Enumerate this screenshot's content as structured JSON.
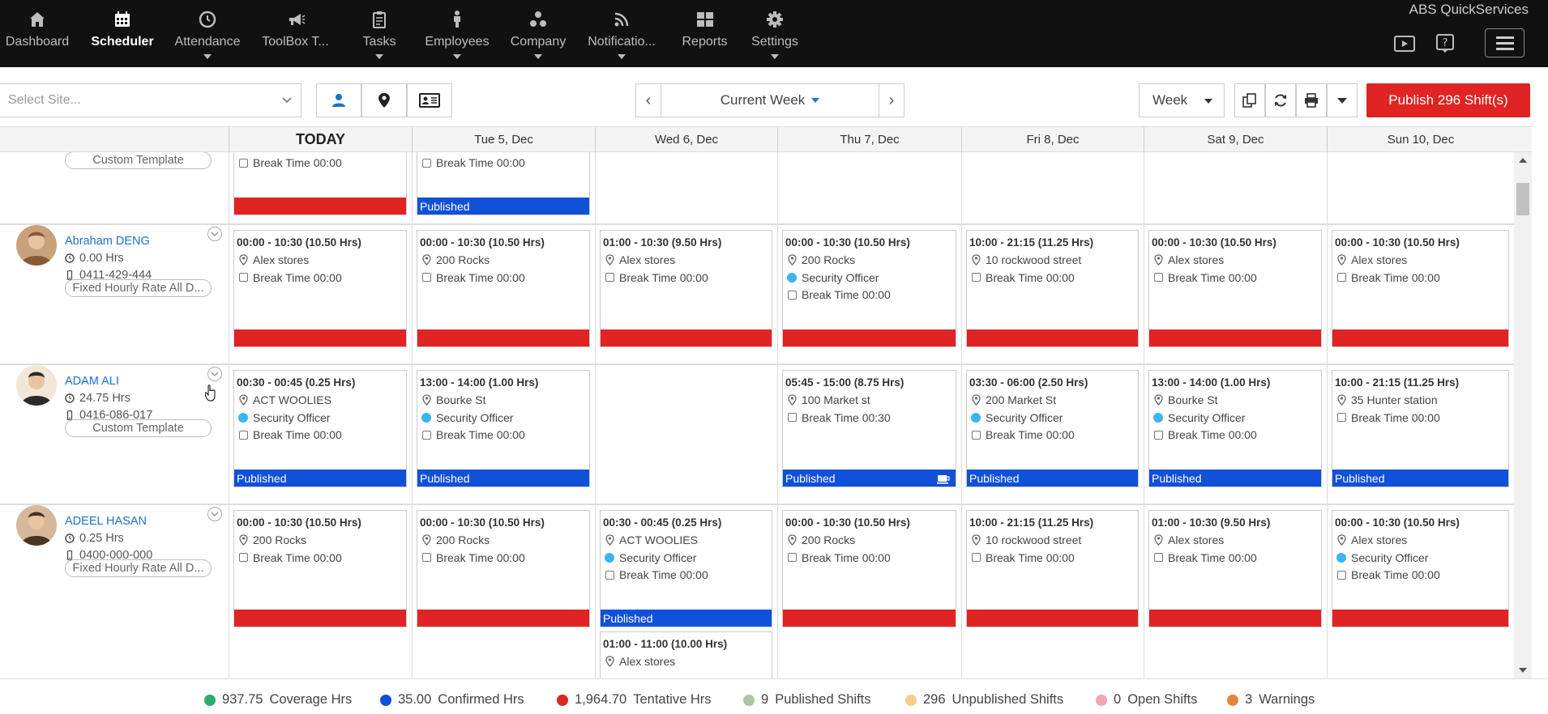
{
  "app": {
    "brand": "ABS QuickServices"
  },
  "nav": {
    "items": [
      {
        "label": "Dashboard",
        "icon": "home-icon"
      },
      {
        "label": "Scheduler",
        "icon": "calendar-icon",
        "active": true
      },
      {
        "label": "Attendance",
        "icon": "clock-icon"
      },
      {
        "label": "ToolBox T...",
        "icon": "megaphone-icon"
      },
      {
        "label": "Tasks",
        "icon": "clipboard-icon"
      },
      {
        "label": "Employees",
        "icon": "person-icon"
      },
      {
        "label": "Company",
        "icon": "org-icon"
      },
      {
        "label": "Notificatio...",
        "icon": "rss-icon"
      },
      {
        "label": "Reports",
        "icon": "grid-icon"
      },
      {
        "label": "Settings",
        "icon": "gear-icon"
      }
    ]
  },
  "toolbar": {
    "site_placeholder": "Select Site...",
    "week_label": "Current Week",
    "prev": "‹",
    "next": "›",
    "view": "Week",
    "publish_label": "Publish 296 Shift(s)"
  },
  "days": [
    "TODAY",
    "Tue 5, Dec",
    "Wed 6, Dec",
    "Thu 7, Dec",
    "Fri 8, Dec",
    "Sat 9, Dec",
    "Sun 10, Dec"
  ],
  "top_partial": {
    "employee_tag": "Custom Template",
    "cells": [
      {
        "lines": [
          {
            "type": "break",
            "text": "Break Time 00:00"
          }
        ],
        "status": ""
      },
      {
        "lines": [
          {
            "type": "break",
            "text": "Break Time 00:00"
          }
        ],
        "status": "Published"
      }
    ]
  },
  "employees": [
    {
      "name": "Abraham DENG",
      "hours": "0.00 Hrs",
      "phone": "0411-429-444",
      "tag": "Fixed Hourly Rate All D...",
      "shifts": [
        {
          "day": 0,
          "time": "00:00 - 10:30 (10.50 Hrs)",
          "lines": [
            {
              "type": "loc",
              "text": "Alex stores"
            },
            {
              "type": "break",
              "text": "Break Time 00:00"
            }
          ],
          "status": ""
        },
        {
          "day": 1,
          "time": "00:00 - 10:30 (10.50 Hrs)",
          "lines": [
            {
              "type": "loc",
              "text": "200 Rocks"
            },
            {
              "type": "break",
              "text": "Break Time 00:00"
            }
          ],
          "status": ""
        },
        {
          "day": 2,
          "time": "01:00 - 10:30 (9.50 Hrs)",
          "lines": [
            {
              "type": "loc",
              "text": "Alex stores"
            },
            {
              "type": "break",
              "text": "Break Time 00:00"
            }
          ],
          "status": ""
        },
        {
          "day": 3,
          "time": "00:00 - 10:30 (10.50 Hrs)",
          "lines": [
            {
              "type": "loc",
              "text": "200 Rocks"
            },
            {
              "type": "role",
              "text": "Security Officer"
            },
            {
              "type": "break",
              "text": "Break Time 00:00"
            }
          ],
          "status": ""
        },
        {
          "day": 4,
          "time": "10:00 - 21:15 (11.25 Hrs)",
          "lines": [
            {
              "type": "loc",
              "text": "10 rockwood street"
            },
            {
              "type": "break",
              "text": "Break Time 00:00"
            }
          ],
          "status": ""
        },
        {
          "day": 5,
          "time": "00:00 - 10:30 (10.50 Hrs)",
          "lines": [
            {
              "type": "loc",
              "text": "Alex stores"
            },
            {
              "type": "break",
              "text": "Break Time 00:00"
            }
          ],
          "status": ""
        },
        {
          "day": 6,
          "time": "00:00 - 10:30 (10.50 Hrs)",
          "lines": [
            {
              "type": "loc",
              "text": "Alex stores"
            },
            {
              "type": "break",
              "text": "Break Time 00:00"
            }
          ],
          "status": ""
        }
      ]
    },
    {
      "name": "ADAM ALI",
      "hours": "24.75 Hrs",
      "phone": "0416-086-017",
      "tag": "Custom Template",
      "shifts": [
        {
          "day": 0,
          "time": "00:30 - 00:45 (0.25 Hrs)",
          "lines": [
            {
              "type": "loc",
              "text": "ACT WOOLIES"
            },
            {
              "type": "role",
              "text": "Security Officer"
            },
            {
              "type": "break",
              "text": "Break Time 00:00"
            }
          ],
          "status": "Published"
        },
        {
          "day": 1,
          "time": "13:00 - 14:00 (1.00 Hrs)",
          "lines": [
            {
              "type": "loc",
              "text": "Bourke St"
            },
            {
              "type": "role",
              "text": "Security Officer"
            },
            {
              "type": "break",
              "text": "Break Time 00:00"
            }
          ],
          "status": "Published"
        },
        {
          "day": 3,
          "time": "05:45 - 15:00 (8.75 Hrs)",
          "lines": [
            {
              "type": "loc",
              "text": "100 Market st"
            },
            {
              "type": "break",
              "text": "Break Time 00:30"
            }
          ],
          "status": "Published",
          "coffee": true
        },
        {
          "day": 4,
          "time": "03:30 - 06:00 (2.50 Hrs)",
          "lines": [
            {
              "type": "loc",
              "text": "200 Market St"
            },
            {
              "type": "role",
              "text": "Security Officer"
            },
            {
              "type": "break",
              "text": "Break Time 00:00"
            }
          ],
          "status": "Published"
        },
        {
          "day": 5,
          "time": "13:00 - 14:00 (1.00 Hrs)",
          "lines": [
            {
              "type": "loc",
              "text": "Bourke St"
            },
            {
              "type": "role",
              "text": "Security Officer"
            },
            {
              "type": "break",
              "text": "Break Time 00:00"
            }
          ],
          "status": "Published"
        },
        {
          "day": 6,
          "time": "10:00 - 21:15 (11.25 Hrs)",
          "lines": [
            {
              "type": "loc",
              "text": "35 Hunter station"
            },
            {
              "type": "break",
              "text": "Break Time 00:00"
            }
          ],
          "status": "Published"
        }
      ]
    },
    {
      "name": "ADEEL HASAN",
      "hours": "0.25 Hrs",
      "phone": "0400-000-000",
      "tag": "Fixed Hourly Rate All D...",
      "shifts": [
        {
          "day": 0,
          "time": "00:00 - 10:30 (10.50 Hrs)",
          "lines": [
            {
              "type": "loc",
              "text": "200 Rocks"
            },
            {
              "type": "break",
              "text": "Break Time 00:00"
            }
          ],
          "status": ""
        },
        {
          "day": 1,
          "time": "00:00 - 10:30 (10.50 Hrs)",
          "lines": [
            {
              "type": "loc",
              "text": "200 Rocks"
            },
            {
              "type": "break",
              "text": "Break Time 00:00"
            }
          ],
          "status": ""
        },
        {
          "day": 2,
          "time": "00:30 - 00:45 (0.25 Hrs)",
          "lines": [
            {
              "type": "loc",
              "text": "ACT WOOLIES"
            },
            {
              "type": "role",
              "text": "Security Officer"
            },
            {
              "type": "break",
              "text": "Break Time 00:00"
            }
          ],
          "status": "Published"
        },
        {
          "day": 2,
          "time": "01:00 - 11:00 (10.00 Hrs)",
          "lines": [
            {
              "type": "loc",
              "text": "Alex stores"
            }
          ],
          "status": "",
          "second": true
        },
        {
          "day": 3,
          "time": "00:00 - 10:30 (10.50 Hrs)",
          "lines": [
            {
              "type": "loc",
              "text": "200 Rocks"
            },
            {
              "type": "break",
              "text": "Break Time 00:00"
            }
          ],
          "status": ""
        },
        {
          "day": 4,
          "time": "10:00 - 21:15 (11.25 Hrs)",
          "lines": [
            {
              "type": "loc",
              "text": "10 rockwood street"
            },
            {
              "type": "break",
              "text": "Break Time 00:00"
            }
          ],
          "status": ""
        },
        {
          "day": 5,
          "time": "01:00 - 10:30 (9.50 Hrs)",
          "lines": [
            {
              "type": "loc",
              "text": "Alex stores"
            },
            {
              "type": "break",
              "text": "Break Time 00:00"
            }
          ],
          "status": ""
        },
        {
          "day": 6,
          "time": "00:00 - 10:30 (10.50 Hrs)",
          "lines": [
            {
              "type": "loc",
              "text": "Alex stores"
            },
            {
              "type": "role",
              "text": "Security Officer"
            },
            {
              "type": "break",
              "text": "Break Time 00:00"
            }
          ],
          "status": ""
        }
      ]
    }
  ],
  "footer": {
    "items": [
      {
        "value": "937.75",
        "label": "Coverage Hrs",
        "color": "#2eaa6e"
      },
      {
        "value": "35.00",
        "label": "Confirmed Hrs",
        "color": "#1150d8"
      },
      {
        "value": "1,964.70",
        "label": "Tentative Hrs",
        "color": "#e02323"
      },
      {
        "value": "9",
        "label": "Published Shifts",
        "color": "#a9c8a0"
      },
      {
        "value": "296",
        "label": "Unpublished Shifts",
        "color": "#f5cf86"
      },
      {
        "value": "0",
        "label": "Open Shifts",
        "color": "#f0a6b5"
      },
      {
        "value": "3",
        "label": "Warnings",
        "color": "#e0873a"
      }
    ]
  },
  "colors": {
    "published": "#1150d8",
    "unpublished": "#e02323",
    "role_dot": "#3bb4f0",
    "link": "#1a73c8"
  }
}
